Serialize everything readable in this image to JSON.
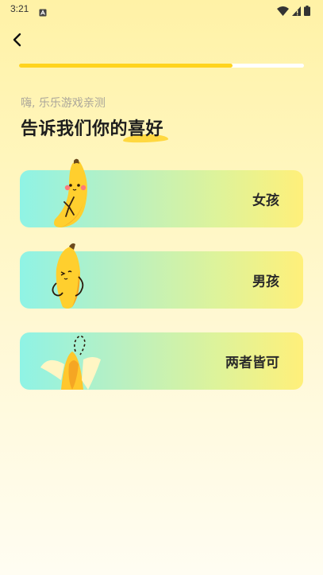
{
  "status": {
    "time": "3:21"
  },
  "progress": {
    "value": 0.75
  },
  "header": {
    "subtitle": "嗨, 乐乐游戏亲测",
    "title_main": "告诉我们你的",
    "title_accent": "喜好"
  },
  "options": [
    {
      "label": "女孩"
    },
    {
      "label": "男孩"
    },
    {
      "label": "两者皆可"
    }
  ],
  "colors": {
    "accent": "#FFD41E",
    "card_start": "#8FF3E5",
    "card_end": "#FFF07A"
  }
}
